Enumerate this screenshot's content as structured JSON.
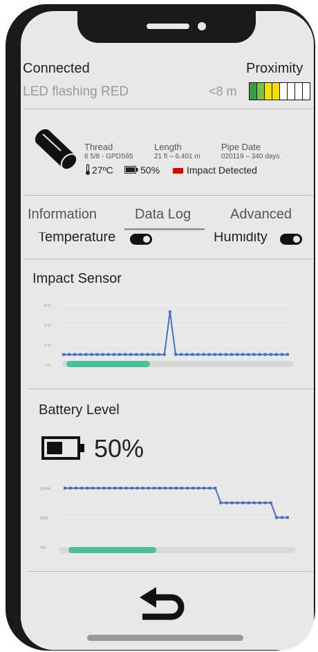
{
  "status": {
    "connection": "Connected",
    "led": "LED flashing RED",
    "proximity_label": "Proximity",
    "proximity_value": "<8 m",
    "proximity_segments": [
      "#3f9b3f",
      "#77c43f",
      "#f2e100",
      "#f2e100",
      "#ffffff",
      "#ffffff",
      "#ffffff",
      "#ffffff"
    ]
  },
  "pipe": {
    "thread_label": "Thread",
    "thread_value": "6 5/8 - GPDS65",
    "length_label": "Length",
    "length_value": "21 ft – 6.401 m",
    "date_label": "Pipe Date",
    "date_value": "020119 – 340 days",
    "temperature": "27ºC",
    "battery": "50%",
    "impact": "Impact Detected",
    "impact_color": "#e00000"
  },
  "tabs": [
    "Information",
    "Data Log",
    "Advanced"
  ],
  "active_tab": "Data Log",
  "toggles": [
    {
      "label": "Temperature",
      "on": true
    },
    {
      "label": "Humidity",
      "on": true
    }
  ],
  "impact_chart": {
    "title": "Impact Sensor",
    "y_ticks": [
      "6 G",
      "4 G",
      "2 G",
      "- G"
    ],
    "line_color": "#4472c4",
    "scroll_fraction": 0.36
  },
  "battery_panel": {
    "title": "Battery Level",
    "value": "50%",
    "level_fraction": 0.5,
    "y_ticks": [
      "100%",
      "50%",
      "0%"
    ],
    "scroll_fraction": 0.37
  },
  "chart_data": [
    {
      "type": "line",
      "title": "Impact Sensor",
      "ylim": [
        0,
        6
      ],
      "y_ticks": [
        "6 G",
        "4 G",
        "2 G",
        "- G"
      ],
      "x": [
        0,
        1,
        2,
        3,
        4,
        5,
        6,
        7,
        8,
        9,
        10,
        11,
        12,
        13,
        14,
        15,
        16,
        17,
        18,
        19,
        20,
        21,
        22,
        23,
        24,
        25,
        26,
        27,
        28,
        29,
        30,
        31,
        32,
        33,
        34,
        35,
        36,
        37,
        38,
        39,
        40
      ],
      "series": [
        {
          "values": [
            1,
            1,
            1,
            1,
            1,
            1,
            1,
            1,
            1,
            1,
            1,
            1,
            1,
            1,
            1,
            1,
            1,
            1,
            1,
            5.3,
            1,
            1,
            1,
            1,
            1,
            1,
            1,
            1,
            1,
            1,
            1,
            1,
            1,
            1,
            1,
            1,
            1,
            1,
            1,
            1,
            1
          ]
        }
      ]
    },
    {
      "type": "line",
      "title": "Battery Level",
      "ylim": [
        0,
        100
      ],
      "y_ticks": [
        "100%",
        "50%",
        "0%"
      ],
      "x": [
        0,
        1,
        2,
        3,
        4,
        5,
        6,
        7,
        8,
        9,
        10,
        11,
        12,
        13,
        14,
        15,
        16,
        17,
        18,
        19,
        20,
        21,
        22,
        23,
        24,
        25,
        26,
        27,
        28,
        29,
        30,
        31,
        32,
        33,
        34,
        35,
        36,
        37,
        38,
        39,
        40
      ],
      "series": [
        {
          "values": [
            100,
            100,
            100,
            100,
            100,
            100,
            100,
            100,
            100,
            100,
            100,
            100,
            100,
            100,
            100,
            100,
            100,
            100,
            100,
            100,
            100,
            100,
            100,
            100,
            100,
            100,
            100,
            100,
            75,
            75,
            75,
            75,
            75,
            75,
            75,
            75,
            75,
            75,
            50,
            50,
            50
          ]
        }
      ]
    }
  ]
}
